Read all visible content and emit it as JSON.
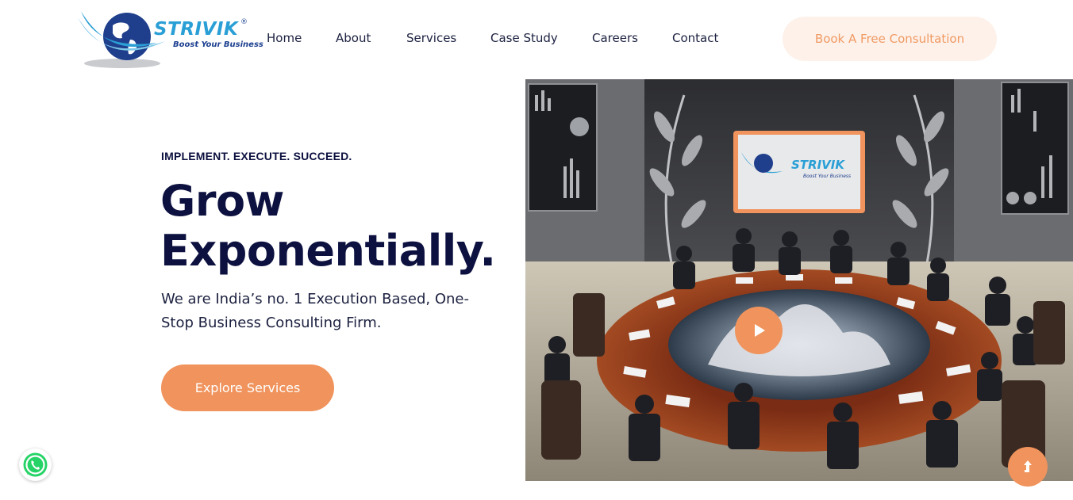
{
  "brand": {
    "name": "STRIVIK",
    "registered_mark": "®",
    "tagline": "Boost Your Business",
    "accent_color": "#f0935c",
    "primary_text_color": "#0d1140",
    "logo_blue": "#2a9fd6"
  },
  "nav": {
    "items": [
      {
        "label": "Home"
      },
      {
        "label": "About"
      },
      {
        "label": "Services"
      },
      {
        "label": "Case Study"
      },
      {
        "label": "Careers"
      },
      {
        "label": "Contact"
      }
    ],
    "cta_label": "Book A Free Consultation"
  },
  "hero": {
    "eyebrow": "IMPLEMENT. EXECUTE. SUCCEED.",
    "headline_line1": "Grow",
    "headline_line2": "Exponentially.",
    "subtext": "We are India’s no. 1 Execution Based, One-Stop Business Consulting Firm.",
    "explore_label": "Explore Services",
    "image_screen_brand": "STRIVIK",
    "image_screen_tagline": "Boost Your Business"
  },
  "floating": {
    "whatsapp_icon": "whatsapp-icon",
    "scroll_top_icon": "arrow-up-icon"
  }
}
